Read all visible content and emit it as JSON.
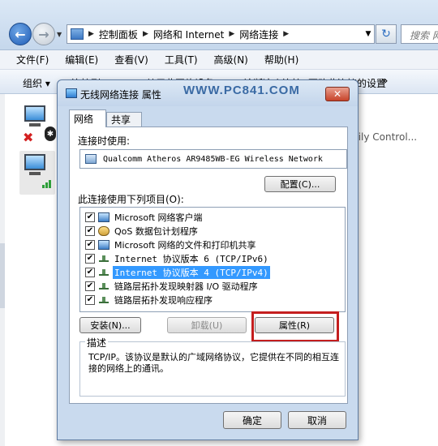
{
  "explorer": {
    "breadcrumb": [
      "控制面板",
      "网络和 Internet",
      "网络连接"
    ],
    "search_placeholder": "搜索 网络",
    "menu": [
      "文件(F)",
      "编辑(E)",
      "查看(V)",
      "工具(T)",
      "高级(N)",
      "帮助(H)"
    ],
    "toolbar": [
      "组织 ▾",
      "连接到",
      "禁用此网络设备",
      "诊断这个连接",
      "更改此连接的设置"
    ],
    "more": "»",
    "partial_right_text": "mily Control..."
  },
  "dialog": {
    "title": "无线网络连接 属性",
    "watermark": "WWW.PC841.COM",
    "close": "✕",
    "tabs": [
      "网络",
      "共享"
    ],
    "connect_using_label": "连接时使用:",
    "adapter": "Qualcomm Atheros AR9485WB-EG Wireless Network",
    "configure": "配置(C)...",
    "items_label": "此连接使用下列项目(O):",
    "items": [
      {
        "text": "Microsoft 网络客户端",
        "checked": "✔"
      },
      {
        "text": "QoS 数据包计划程序",
        "checked": "✔"
      },
      {
        "text": "Microsoft 网络的文件和打印机共享",
        "checked": "✔"
      },
      {
        "text": "Internet 协议版本 6 (TCP/IPv6)",
        "checked": "✔"
      },
      {
        "text": "Internet 协议版本 4 (TCP/IPv4)",
        "checked": "✔"
      },
      {
        "text": "链路层拓扑发现映射器 I/O 驱动程序",
        "checked": "✔"
      },
      {
        "text": "链路层拓扑发现响应程序",
        "checked": "✔"
      }
    ],
    "install": "安装(N)...",
    "uninstall": "卸载(U)",
    "properties": "属性(R)",
    "description_title": "描述",
    "description": "TCP/IP。该协议是默认的广域网络协议，它提供在不同的相互连接的网络上的通讯。",
    "ok": "确定",
    "cancel": "取消"
  }
}
